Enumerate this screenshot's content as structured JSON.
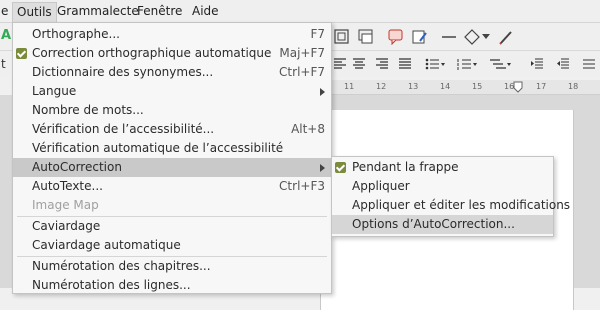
{
  "menubar": {
    "items": [
      {
        "label": "e"
      },
      {
        "label": "Outils"
      },
      {
        "label": "Grammalecte"
      },
      {
        "label": "Fenêtre"
      },
      {
        "label": "Aide"
      }
    ]
  },
  "toolbar_left_char": "A",
  "toolbar2_left_char": "t",
  "ruler_ticks": [
    "11",
    "12",
    "13",
    "14",
    "15",
    "16",
    "17",
    "18"
  ],
  "menu": {
    "items": [
      {
        "label": "Orthographe...",
        "shortcut": "F7"
      },
      {
        "label": "Correction orthographique automatique",
        "shortcut": "Maj+F7",
        "checked": true
      },
      {
        "label": "Dictionnaire des synonymes...",
        "shortcut": "Ctrl+F7"
      },
      {
        "label": "Langue"
      },
      {
        "label": "Nombre de mots..."
      },
      {
        "label": "Vérification de l’accessibilité...",
        "shortcut": "Alt+8"
      },
      {
        "label": "Vérification automatique de l’accessibilité"
      },
      {
        "label": "AutoCorrection"
      },
      {
        "label": "AutoTexte...",
        "shortcut": "Ctrl+F3"
      },
      {
        "label": "Image Map",
        "disabled": true
      },
      {
        "label": "Caviardage"
      },
      {
        "label": "Caviardage automatique"
      },
      {
        "label": "Numérotation des chapitres..."
      },
      {
        "label": "Numérotation des lignes..."
      }
    ]
  },
  "submenu": {
    "items": [
      {
        "label": "Pendant la frappe",
        "checked": true
      },
      {
        "label": "Appliquer"
      },
      {
        "label": "Appliquer et éditer les modifications"
      },
      {
        "label": "Options d’AutoCorrection..."
      }
    ]
  },
  "colors": {
    "check": "#7a8b3b",
    "highlight": "#c9c9c9"
  }
}
